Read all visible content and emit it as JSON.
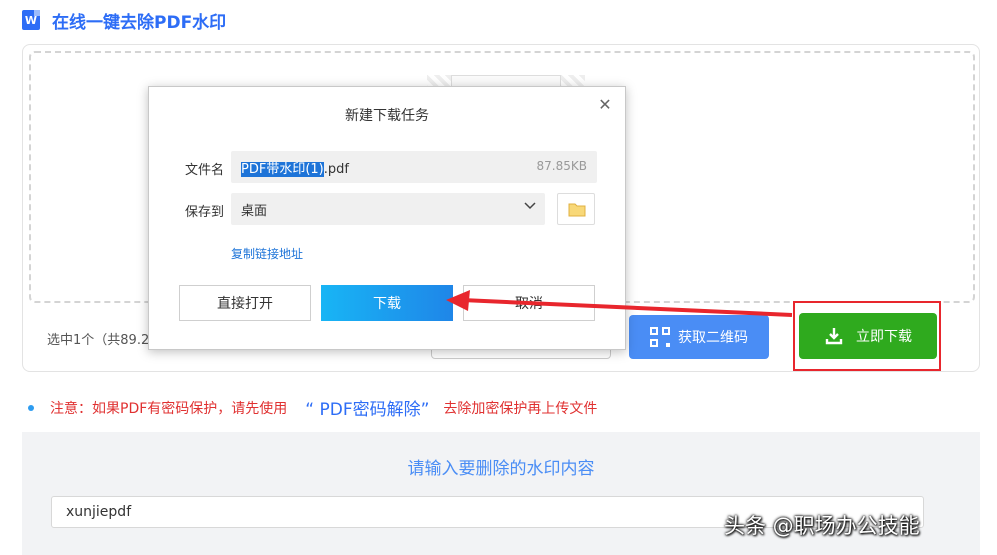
{
  "page": {
    "title": "在线一键去除PDF水印",
    "logo_letter": "W"
  },
  "upload": {
    "selected_info": "选中1个（共89.2"
  },
  "actions": {
    "qr_label": "获取二维码",
    "download_now_label": "立即下载"
  },
  "note": {
    "prefix": "注意：如果PDF有密码保护，请先使用",
    "link": "“ PDF密码解除”",
    "suffix": "去除加密保护再上传文件"
  },
  "watermark_panel": {
    "heading": "请输入要删除的水印内容",
    "input_value": "xunjiepdf"
  },
  "dialog": {
    "title": "新建下载任务",
    "close_glyph": "✕",
    "filename_label": "文件名",
    "filename_selected": "PDF带水印(1)",
    "filename_ext": ".pdf",
    "file_size": "87.85KB",
    "saveto_label": "保存到",
    "saveto_value": "桌面",
    "copy_link": "复制链接地址",
    "open_label": "直接打开",
    "download_label": "下载",
    "cancel_label": "取消"
  },
  "attribution": "头条 @职场办公技能",
  "colors": {
    "brand_blue": "#2d6df6",
    "qr_blue": "#4a8df5",
    "download_green": "#2faa1e",
    "annotation_red": "#e8262d"
  }
}
